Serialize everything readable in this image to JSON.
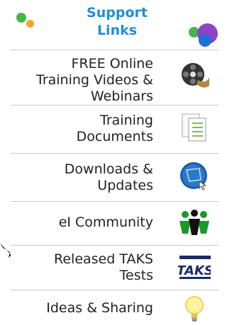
{
  "header": {
    "title_line1": "Support",
    "title_line2": "Links"
  },
  "links": [
    {
      "label_line1": "FREE Online",
      "label_line2": "Training Videos &",
      "label_line3": "Webinars",
      "icon": "film-reel-icon"
    },
    {
      "label_line1": "Training",
      "label_line2": "Documents",
      "icon": "documents-icon"
    },
    {
      "label_line1": "Downloads &",
      "label_line2": "Updates",
      "icon": "globe-download-icon"
    },
    {
      "label_line1": "eI Community",
      "icon": "people-community-icon"
    },
    {
      "label_line1": "Released TAKS",
      "label_line2": "Tests",
      "icon": "taks-logo-icon",
      "icon_text": "TAKS"
    },
    {
      "label_line1": "Ideas & Sharing",
      "icon": "lightbulb-icon"
    }
  ],
  "colors": {
    "title": "#1f8fd6",
    "divider": "#c8c8c8",
    "dot_green": "#48b54b",
    "dot_orange": "#f5a623",
    "dot_purple": "#8e44c8",
    "dot_blue": "#1f6fd6"
  }
}
